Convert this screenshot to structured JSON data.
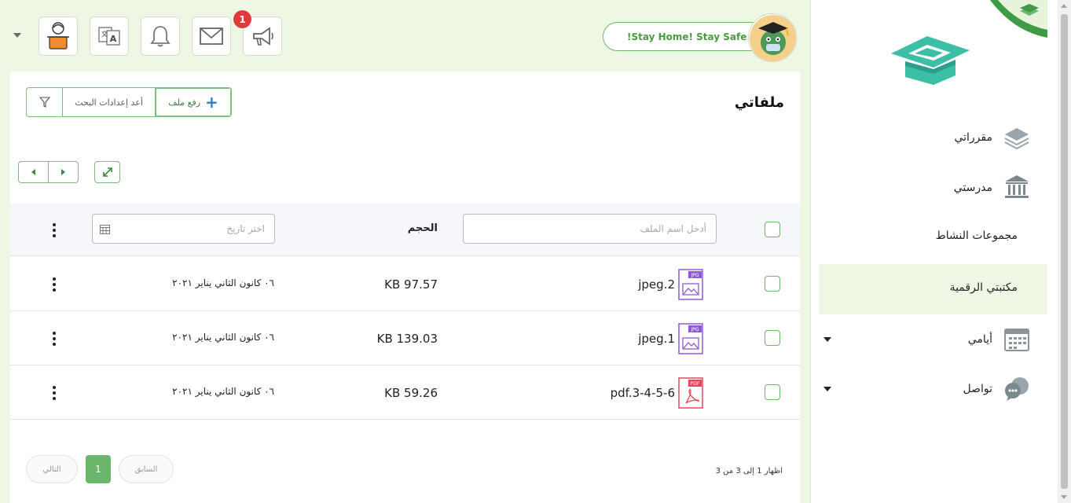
{
  "topbar": {
    "notification_count": "1",
    "stay_home_text": "!Stay Home! Stay Safe"
  },
  "page": {
    "title": "ملفاتي",
    "upload_label": "رفع ملف",
    "reset_label": "أعد إعدادات البحث"
  },
  "table": {
    "name_placeholder": "أدخل اسم الملف",
    "size_header": "الحجم",
    "date_placeholder": "اختر تاريخ",
    "rows": [
      {
        "name": "jpeg.2",
        "size": "KB 97.57",
        "date": "٠٦ كانون الثاني يناير ٢٠٢١",
        "type": "JPG"
      },
      {
        "name": "jpeg.1",
        "size": "KB 139.03",
        "date": "٠٦ كانون الثاني يناير ٢٠٢١",
        "type": "JPG"
      },
      {
        "name": "pdf.3-4-5-6",
        "size": "KB 59.26",
        "date": "٠٦ كانون الثاني يناير ٢٠٢١",
        "type": "PDF"
      }
    ]
  },
  "pagination": {
    "info": "اظهار 1 إلى 3 من 3",
    "prev": "السابق",
    "current": "1",
    "next": "التالي"
  },
  "sidebar": {
    "items": [
      {
        "label": "مقرراتي",
        "icon": "layers-icon"
      },
      {
        "label": "مدرستي",
        "icon": "school-building-icon"
      },
      {
        "label": "مجموعات النشاط"
      },
      {
        "label": "مكتبتي الرقمية",
        "active": true
      },
      {
        "label": "أيامي",
        "icon": "calendar-icon",
        "expandable": true
      },
      {
        "label": "تواصل",
        "icon": "chat-icon",
        "expandable": true
      }
    ]
  },
  "colors": {
    "accent_green": "#6cb66c",
    "main_bg": "#eef6e4",
    "badge_red": "#e0393e",
    "jpg_purple": "#8e5ad6",
    "pdf_red": "#e5475c"
  }
}
